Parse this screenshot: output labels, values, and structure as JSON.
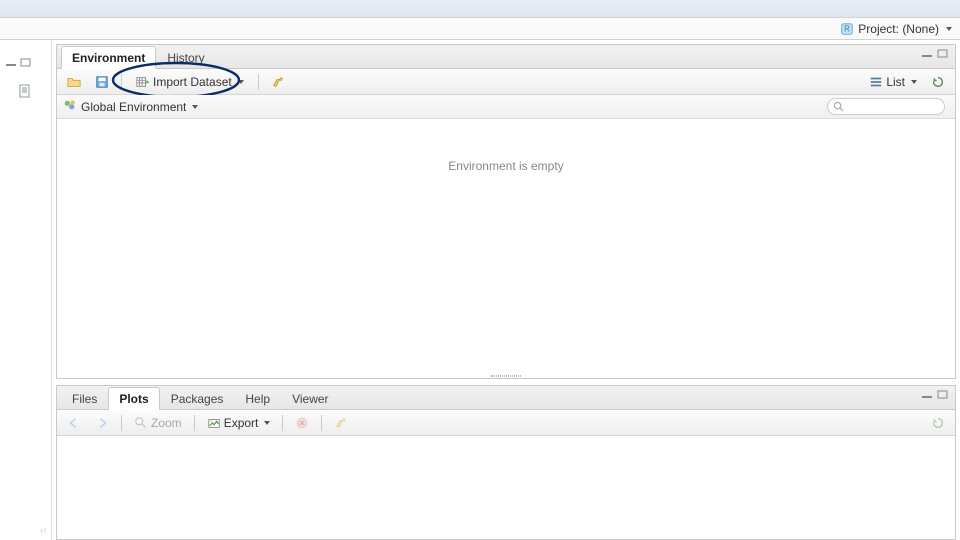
{
  "project_bar": {
    "label": "Project: (None)"
  },
  "env_pane": {
    "tabs": [
      {
        "label": "Environment",
        "active": true
      },
      {
        "label": "History",
        "active": false
      }
    ],
    "toolbar": {
      "import_label": "Import Dataset",
      "view_mode": "List"
    },
    "scope_label": "Global Environment",
    "empty_message": "Environment is empty",
    "search_placeholder": ""
  },
  "plots_pane": {
    "tabs": [
      {
        "label": "Files",
        "active": false
      },
      {
        "label": "Plots",
        "active": true
      },
      {
        "label": "Packages",
        "active": false
      },
      {
        "label": "Help",
        "active": false
      },
      {
        "label": "Viewer",
        "active": false
      }
    ],
    "toolbar": {
      "zoom_label": "Zoom",
      "export_label": "Export"
    }
  },
  "annotation": {
    "circle_color": "#0b2b63"
  }
}
